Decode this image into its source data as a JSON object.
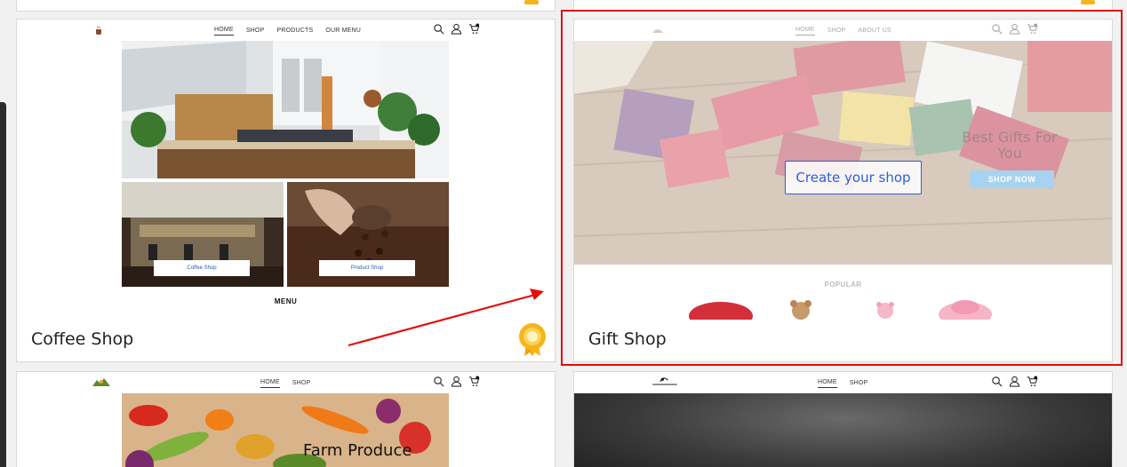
{
  "cards": {
    "coffee": {
      "title": "Coffee Shop",
      "nav": [
        "HOME",
        "SHOP",
        "PRODUCTS",
        "OUR MENU"
      ],
      "tile_left_button": "Coffee Shop",
      "tile_right_button": "Product Shop",
      "section_label": "MENU"
    },
    "gift": {
      "title": "Gift Shop",
      "nav": [
        "HOME",
        "SHOP",
        "ABOUT US"
      ],
      "hero_text": "Best Gifts For You",
      "hero_button": "SHOP NOW",
      "create_button": "Create your shop",
      "section_label": "POPULAR"
    },
    "farm": {
      "nav": [
        "HOME",
        "SHOP"
      ],
      "hero_title": "Farm Produce"
    },
    "dark": {
      "nav": [
        "HOME",
        "SHOP"
      ]
    }
  },
  "colors": {
    "highlight": "#e60b0b",
    "accent_blue": "#2b5fd9",
    "badge_gold": "#f5b51a"
  },
  "icons": [
    "search-icon",
    "user-icon",
    "cart-icon",
    "award-badge-icon"
  ]
}
